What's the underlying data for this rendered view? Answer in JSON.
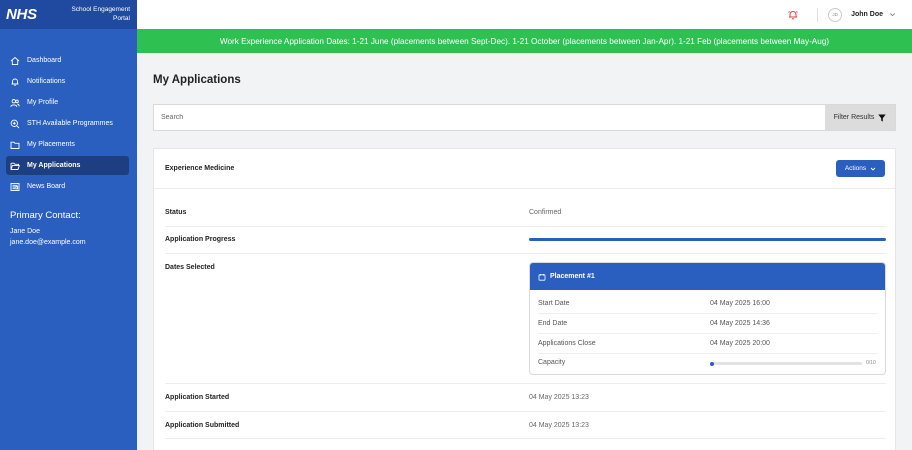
{
  "brand": {
    "logo": "NHS",
    "portal_line1": "School Engagement",
    "portal_line2": "Portal"
  },
  "sidebar": {
    "items": [
      {
        "label": "Dashboard",
        "icon": "home-icon",
        "active": false
      },
      {
        "label": "Notifications",
        "icon": "bell-icon",
        "active": false
      },
      {
        "label": "My Profile",
        "icon": "users-icon",
        "active": false
      },
      {
        "label": "STH Available Programmes",
        "icon": "search-plus-icon",
        "active": false
      },
      {
        "label": "My Placements",
        "icon": "folder-icon",
        "active": false
      },
      {
        "label": "My Applications",
        "icon": "folder-open-icon",
        "active": true
      },
      {
        "label": "News Board",
        "icon": "newspaper-icon",
        "active": false
      }
    ],
    "contact": {
      "title": "Primary Contact:",
      "name": "Jane Doe",
      "email": "jane.doe@example.com"
    }
  },
  "header": {
    "avatar_initials": "JD",
    "user_name": "John Doe"
  },
  "banner": {
    "text": "Work Experience Application Dates: 1-21 June (placements between Sept-Dec). 1-21 October (placements between Jan-Apr). 1-21 Feb (placements between May-Aug)"
  },
  "main": {
    "title": "My Applications",
    "search": {
      "placeholder": "Search",
      "value": ""
    },
    "filter_label": "Filter Results"
  },
  "application": {
    "title": "Experience Medicine",
    "actions_label": "Actions",
    "status_label": "Status",
    "status_value": "Confirmed",
    "progress_label": "Application Progress",
    "progress_value": 1.0,
    "dates_label": "Dates Selected",
    "placement": {
      "title": "Placement #1",
      "start_label": "Start Date",
      "start_value": "04 May 2025 16:00",
      "end_label": "End Date",
      "end_value": "04 May 2025 14:36",
      "close_label": "Applications Close",
      "close_value": "04 May 2025 20:00",
      "capacity_label": "Capacity",
      "capacity_text": "0/10",
      "capacity_fraction": 0.0
    },
    "started_label": "Application Started",
    "started_value": "04 May 2025 13:23",
    "submitted_label": "Application Submitted",
    "submitted_value": "04 May 2025 13:23"
  },
  "colors": {
    "primary": "#2b5fbf",
    "sidebar": "#2b5fbf",
    "banner": "#2fc052",
    "bell": "#e03b3b"
  }
}
